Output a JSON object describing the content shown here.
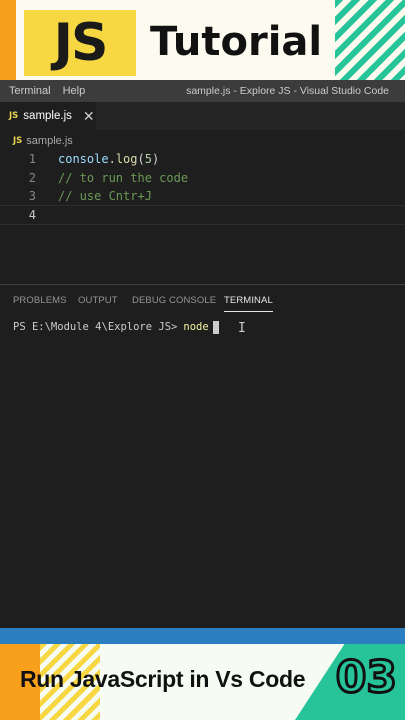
{
  "banner": {
    "logo_text": "JS",
    "title": "Tutorial",
    "colors": {
      "logo_bg": "#f7d742",
      "accent_orange": "#f8a01c",
      "accent_green": "#27c49a"
    }
  },
  "titlebar": {
    "menu": [
      "Terminal",
      "Help"
    ],
    "window_title": "sample.js - Explore JS - Visual Studio Code"
  },
  "tabs": [
    {
      "icon": "javascript-file-icon",
      "badge": "JS",
      "label": "sample.js",
      "close_icon": "close-icon",
      "close_glyph": "✕"
    }
  ],
  "breadcrumb": {
    "badge": "JS",
    "label": "sample.js"
  },
  "editor": {
    "line_numbers": [
      "1",
      "2",
      "3",
      "4"
    ],
    "lines": {
      "l1": {
        "obj": "console",
        "dot": ".",
        "fn": "log",
        "open": "(",
        "num": "5",
        "close": ")"
      },
      "l2": "// to run the code",
      "l3": "// use Cntr+J",
      "l4": ""
    }
  },
  "panel": {
    "tabs": [
      "PROBLEMS",
      "OUTPUT",
      "DEBUG CONSOLE",
      "TERMINAL"
    ],
    "active_tab": "TERMINAL",
    "terminal": {
      "prompt": "PS E:\\Module 4\\Explore JS>",
      "command": "node"
    },
    "ibeam_glyph": "I"
  },
  "bottom_banner": {
    "title": "Run JavaScript in Vs Code",
    "episode": "03"
  }
}
